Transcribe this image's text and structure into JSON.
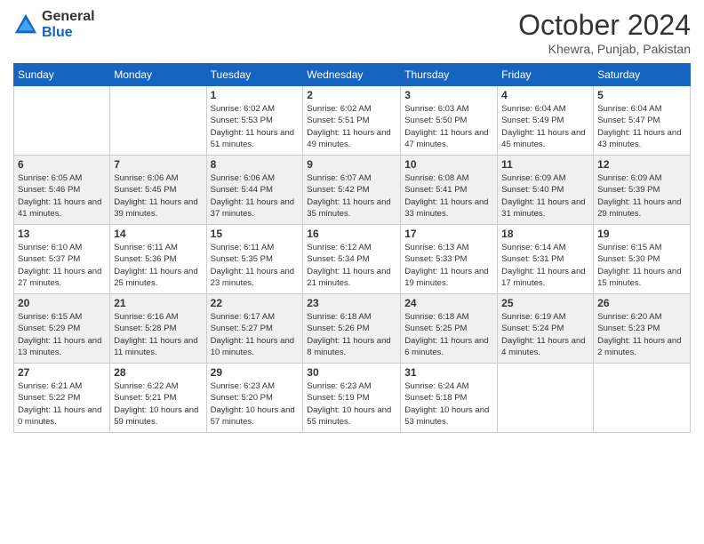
{
  "header": {
    "logo_general": "General",
    "logo_blue": "Blue",
    "month": "October 2024",
    "location": "Khewra, Punjab, Pakistan"
  },
  "weekdays": [
    "Sunday",
    "Monday",
    "Tuesday",
    "Wednesday",
    "Thursday",
    "Friday",
    "Saturday"
  ],
  "weeks": [
    [
      {
        "day": "",
        "info": ""
      },
      {
        "day": "",
        "info": ""
      },
      {
        "day": "1",
        "info": "Sunrise: 6:02 AM\nSunset: 5:53 PM\nDaylight: 11 hours and 51 minutes."
      },
      {
        "day": "2",
        "info": "Sunrise: 6:02 AM\nSunset: 5:51 PM\nDaylight: 11 hours and 49 minutes."
      },
      {
        "day": "3",
        "info": "Sunrise: 6:03 AM\nSunset: 5:50 PM\nDaylight: 11 hours and 47 minutes."
      },
      {
        "day": "4",
        "info": "Sunrise: 6:04 AM\nSunset: 5:49 PM\nDaylight: 11 hours and 45 minutes."
      },
      {
        "day": "5",
        "info": "Sunrise: 6:04 AM\nSunset: 5:47 PM\nDaylight: 11 hours and 43 minutes."
      }
    ],
    [
      {
        "day": "6",
        "info": "Sunrise: 6:05 AM\nSunset: 5:46 PM\nDaylight: 11 hours and 41 minutes."
      },
      {
        "day": "7",
        "info": "Sunrise: 6:06 AM\nSunset: 5:45 PM\nDaylight: 11 hours and 39 minutes."
      },
      {
        "day": "8",
        "info": "Sunrise: 6:06 AM\nSunset: 5:44 PM\nDaylight: 11 hours and 37 minutes."
      },
      {
        "day": "9",
        "info": "Sunrise: 6:07 AM\nSunset: 5:42 PM\nDaylight: 11 hours and 35 minutes."
      },
      {
        "day": "10",
        "info": "Sunrise: 6:08 AM\nSunset: 5:41 PM\nDaylight: 11 hours and 33 minutes."
      },
      {
        "day": "11",
        "info": "Sunrise: 6:09 AM\nSunset: 5:40 PM\nDaylight: 11 hours and 31 minutes."
      },
      {
        "day": "12",
        "info": "Sunrise: 6:09 AM\nSunset: 5:39 PM\nDaylight: 11 hours and 29 minutes."
      }
    ],
    [
      {
        "day": "13",
        "info": "Sunrise: 6:10 AM\nSunset: 5:37 PM\nDaylight: 11 hours and 27 minutes."
      },
      {
        "day": "14",
        "info": "Sunrise: 6:11 AM\nSunset: 5:36 PM\nDaylight: 11 hours and 25 minutes."
      },
      {
        "day": "15",
        "info": "Sunrise: 6:11 AM\nSunset: 5:35 PM\nDaylight: 11 hours and 23 minutes."
      },
      {
        "day": "16",
        "info": "Sunrise: 6:12 AM\nSunset: 5:34 PM\nDaylight: 11 hours and 21 minutes."
      },
      {
        "day": "17",
        "info": "Sunrise: 6:13 AM\nSunset: 5:33 PM\nDaylight: 11 hours and 19 minutes."
      },
      {
        "day": "18",
        "info": "Sunrise: 6:14 AM\nSunset: 5:31 PM\nDaylight: 11 hours and 17 minutes."
      },
      {
        "day": "19",
        "info": "Sunrise: 6:15 AM\nSunset: 5:30 PM\nDaylight: 11 hours and 15 minutes."
      }
    ],
    [
      {
        "day": "20",
        "info": "Sunrise: 6:15 AM\nSunset: 5:29 PM\nDaylight: 11 hours and 13 minutes."
      },
      {
        "day": "21",
        "info": "Sunrise: 6:16 AM\nSunset: 5:28 PM\nDaylight: 11 hours and 11 minutes."
      },
      {
        "day": "22",
        "info": "Sunrise: 6:17 AM\nSunset: 5:27 PM\nDaylight: 11 hours and 10 minutes."
      },
      {
        "day": "23",
        "info": "Sunrise: 6:18 AM\nSunset: 5:26 PM\nDaylight: 11 hours and 8 minutes."
      },
      {
        "day": "24",
        "info": "Sunrise: 6:18 AM\nSunset: 5:25 PM\nDaylight: 11 hours and 6 minutes."
      },
      {
        "day": "25",
        "info": "Sunrise: 6:19 AM\nSunset: 5:24 PM\nDaylight: 11 hours and 4 minutes."
      },
      {
        "day": "26",
        "info": "Sunrise: 6:20 AM\nSunset: 5:23 PM\nDaylight: 11 hours and 2 minutes."
      }
    ],
    [
      {
        "day": "27",
        "info": "Sunrise: 6:21 AM\nSunset: 5:22 PM\nDaylight: 11 hours and 0 minutes."
      },
      {
        "day": "28",
        "info": "Sunrise: 6:22 AM\nSunset: 5:21 PM\nDaylight: 10 hours and 59 minutes."
      },
      {
        "day": "29",
        "info": "Sunrise: 6:23 AM\nSunset: 5:20 PM\nDaylight: 10 hours and 57 minutes."
      },
      {
        "day": "30",
        "info": "Sunrise: 6:23 AM\nSunset: 5:19 PM\nDaylight: 10 hours and 55 minutes."
      },
      {
        "day": "31",
        "info": "Sunrise: 6:24 AM\nSunset: 5:18 PM\nDaylight: 10 hours and 53 minutes."
      },
      {
        "day": "",
        "info": ""
      },
      {
        "day": "",
        "info": ""
      }
    ]
  ]
}
